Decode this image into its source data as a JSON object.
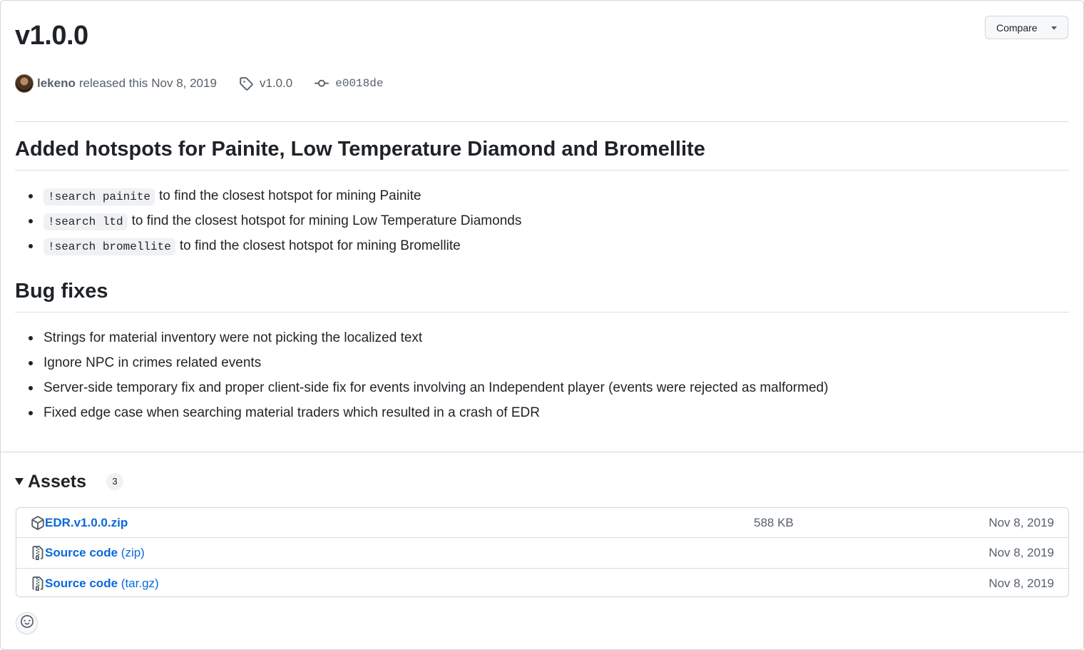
{
  "release": {
    "title": "v1.0.0",
    "author": "lekeno",
    "released_text": "released this",
    "date": "Nov 8, 2019",
    "tag": "v1.0.0",
    "commit": "e0018de"
  },
  "compare_label": "Compare",
  "sections": [
    {
      "heading": "Added hotspots for Painite, Low Temperature Diamond and Bromellite",
      "items": [
        {
          "code": "!search painite",
          "text": "to find the closest hotspot for mining Painite"
        },
        {
          "code": "!search ltd",
          "text": "to find the closest hotspot for mining Low Temperature Diamonds"
        },
        {
          "code": "!search bromellite",
          "text": "to find the closest hotspot for mining Bromellite"
        }
      ]
    },
    {
      "heading": "Bug fixes",
      "items": [
        {
          "text": "Strings for material inventory were not picking the localized text"
        },
        {
          "text": "Ignore NPC in crimes related events"
        },
        {
          "text": "Server-side temporary fix and proper client-side fix for events involving an Independent player (events were rejected as malformed)"
        },
        {
          "text": "Fixed edge case when searching material traders which resulted in a crash of EDR"
        }
      ]
    }
  ],
  "assets": {
    "title": "Assets",
    "count": "3",
    "rows": [
      {
        "icon": "package-icon",
        "name": "EDR.v1.0.0.zip",
        "format": "",
        "size": "588 KB",
        "date": "Nov 8, 2019"
      },
      {
        "icon": "file-zip-icon",
        "name": "Source code",
        "format": "(zip)",
        "size": "",
        "date": "Nov 8, 2019"
      },
      {
        "icon": "file-zip-icon",
        "name": "Source code",
        "format": "(tar.gz)",
        "size": "",
        "date": "Nov 8, 2019"
      }
    ]
  },
  "icons": {
    "tag": "tag-icon",
    "commit": "git-commit-icon",
    "reaction": "smiley-icon",
    "compare_caret": "triangle-down-icon"
  },
  "colors": {
    "link": "#0969da",
    "text": "#1f2328",
    "muted": "#57606a",
    "border": "#d0d7de"
  }
}
